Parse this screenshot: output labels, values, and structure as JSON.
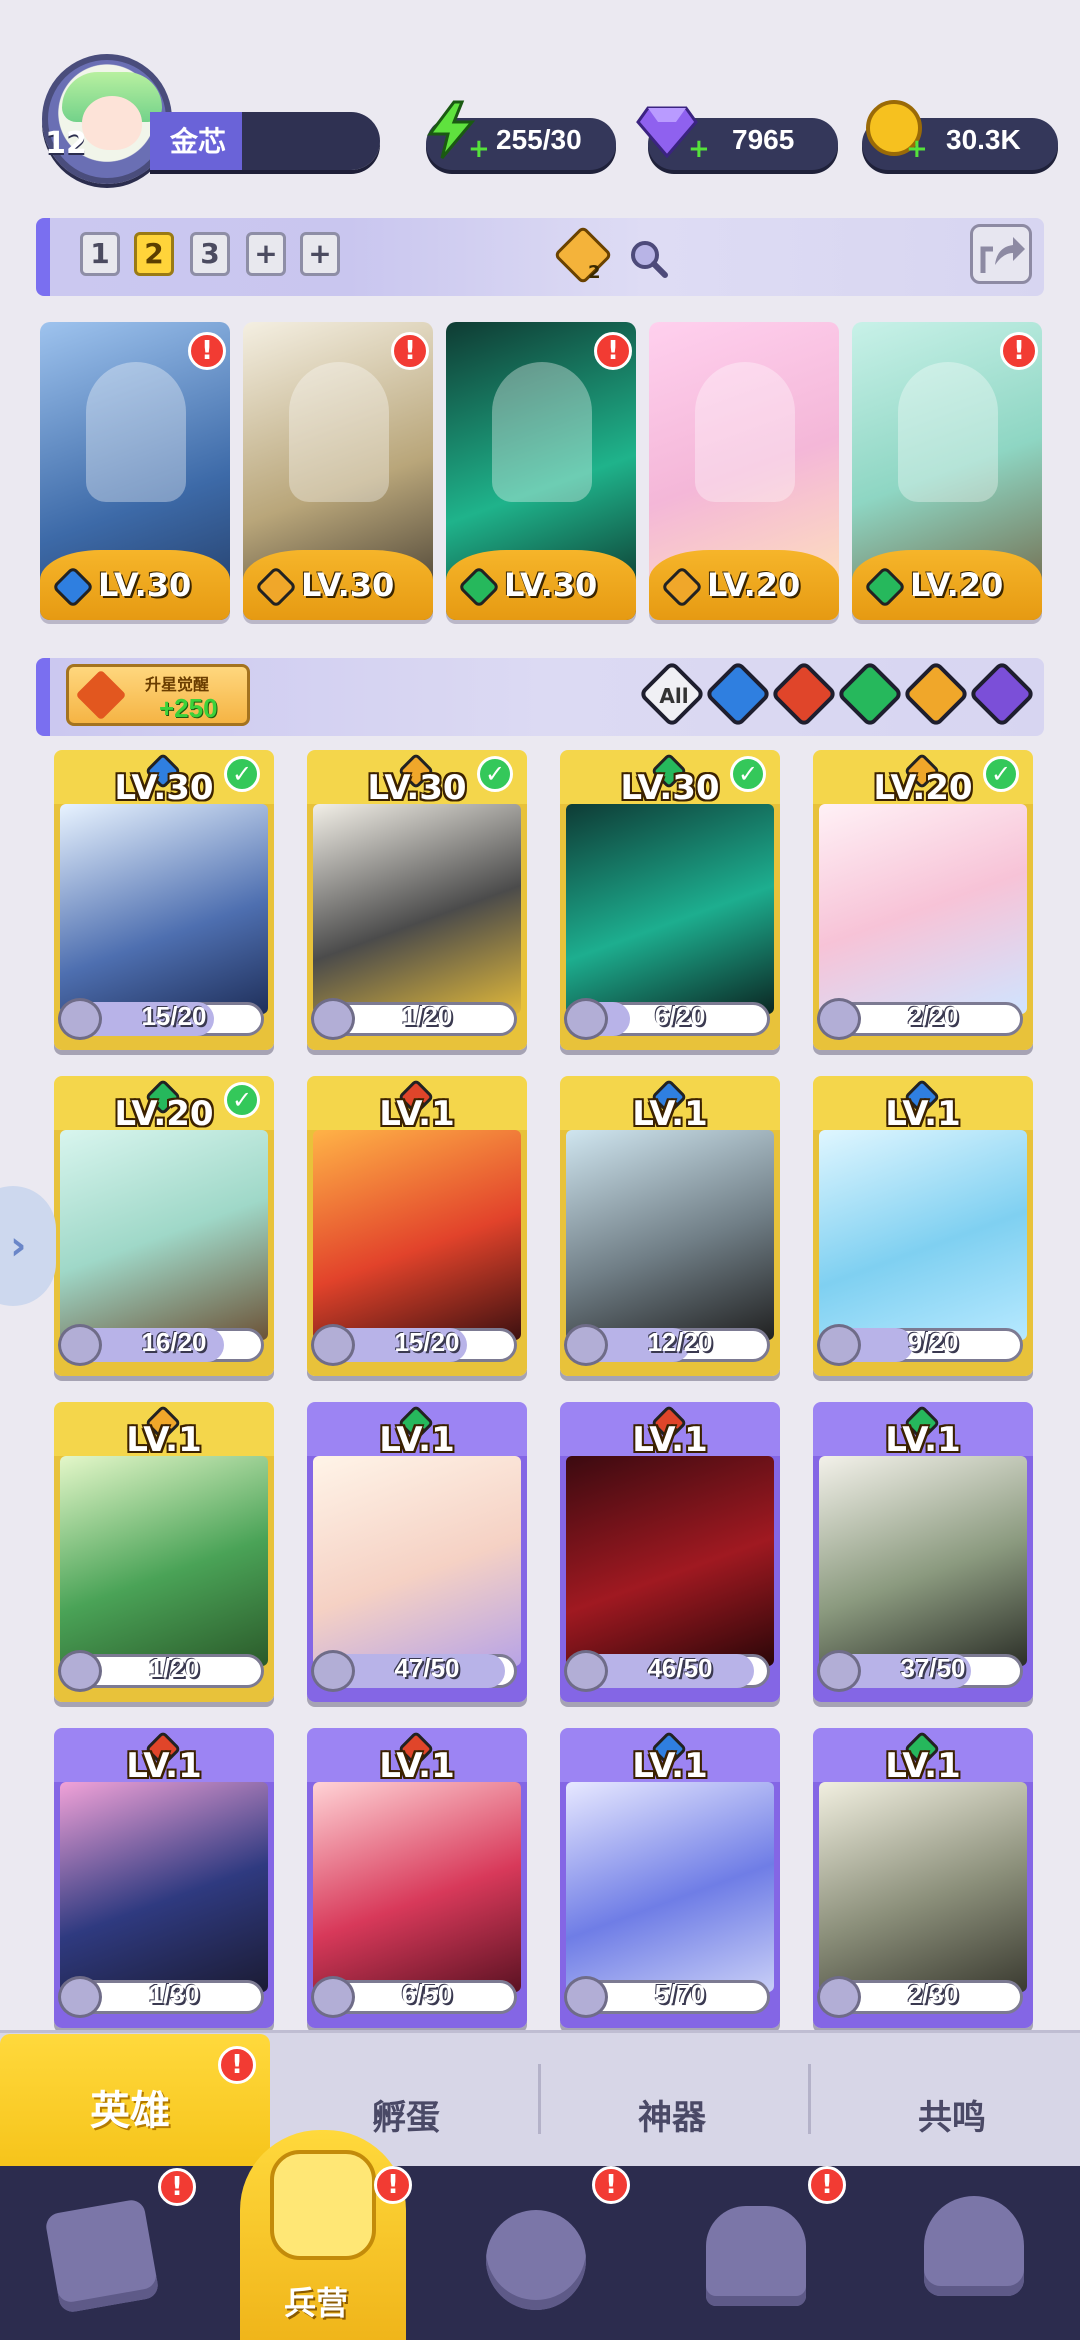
{
  "player": {
    "level": "12",
    "name": "金芯"
  },
  "resources": {
    "energy": "255/30",
    "gems": "7965",
    "gold": "30.3K"
  },
  "team": {
    "slots": [
      "1",
      "2",
      "3",
      "+",
      "+"
    ],
    "active_slot": "2",
    "badge_count": "2",
    "heroes": [
      {
        "level": "LV.30",
        "element": "water"
      },
      {
        "level": "LV.30",
        "element": "light"
      },
      {
        "level": "LV.30",
        "element": "wind"
      },
      {
        "level": "LV.20",
        "element": "light"
      },
      {
        "level": "LV.20",
        "element": "wind"
      }
    ]
  },
  "filter": {
    "star_button_label": "升星觉醒",
    "star_button_value": "+250",
    "all_label": "All",
    "elements": [
      "water",
      "fire",
      "wind",
      "light",
      "dark"
    ]
  },
  "heroes": [
    {
      "level": "LV.30",
      "frags": "15/20",
      "progress": 0.75,
      "element": "water",
      "rarity": "gold",
      "in_team": true
    },
    {
      "level": "LV.30",
      "frags": "1/20",
      "progress": 0.05,
      "element": "light",
      "rarity": "gold",
      "in_team": true
    },
    {
      "level": "LV.30",
      "frags": "6/20",
      "progress": 0.3,
      "element": "wind",
      "rarity": "gold",
      "in_team": true
    },
    {
      "level": "LV.20",
      "frags": "2/20",
      "progress": 0.1,
      "element": "light",
      "rarity": "gold",
      "in_team": true
    },
    {
      "level": "LV.20",
      "frags": "16/20",
      "progress": 0.8,
      "element": "wind",
      "rarity": "gold",
      "in_team": true
    },
    {
      "level": "LV.1",
      "frags": "15/20",
      "progress": 0.75,
      "element": "fire",
      "rarity": "gold",
      "in_team": false
    },
    {
      "level": "LV.1",
      "frags": "12/20",
      "progress": 0.6,
      "element": "water",
      "rarity": "gold",
      "in_team": false
    },
    {
      "level": "LV.1",
      "frags": "9/20",
      "progress": 0.45,
      "element": "water",
      "rarity": "gold",
      "in_team": false
    },
    {
      "level": "LV.1",
      "frags": "1/20",
      "progress": 0.05,
      "element": "light",
      "rarity": "gold",
      "in_team": false
    },
    {
      "level": "LV.1",
      "frags": "47/50",
      "progress": 0.94,
      "element": "wind",
      "rarity": "purple",
      "in_team": false
    },
    {
      "level": "LV.1",
      "frags": "46/50",
      "progress": 0.92,
      "element": "fire",
      "rarity": "purple",
      "in_team": false
    },
    {
      "level": "LV.1",
      "frags": "37/50",
      "progress": 0.74,
      "element": "wind",
      "rarity": "purple",
      "in_team": false
    },
    {
      "level": "LV.1",
      "frags": "1/30",
      "progress": 0.03,
      "element": "fire",
      "rarity": "purple",
      "in_team": false
    },
    {
      "level": "LV.1",
      "frags": "6/50",
      "progress": 0.12,
      "element": "fire",
      "rarity": "purple",
      "in_team": false
    },
    {
      "level": "LV.1",
      "frags": "5/70",
      "progress": 0.07,
      "element": "water",
      "rarity": "purple",
      "in_team": false
    },
    {
      "level": "LV.1",
      "frags": "2/30",
      "progress": 0.07,
      "element": "wind",
      "rarity": "purple",
      "in_team": false
    }
  ],
  "tabs": [
    {
      "label": "英雄",
      "active": true
    },
    {
      "label": "孵蛋",
      "active": false
    },
    {
      "label": "神器",
      "active": false
    },
    {
      "label": "共鸣",
      "active": false
    }
  ],
  "nav": {
    "active_label": "兵营",
    "items": [
      "cards-icon",
      "barracks-icon",
      "map-icon",
      "castle-icon",
      "mushroom-icon"
    ]
  },
  "colors": {
    "water": "#2f7fe0",
    "fire": "#e0452a",
    "wind": "#26b85c",
    "light": "#f0a72a",
    "dark": "#7b4fd8",
    "accent": "#ffd43a"
  }
}
